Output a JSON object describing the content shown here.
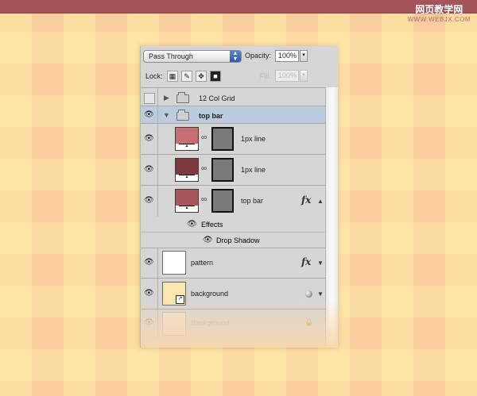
{
  "watermark": {
    "cn": "网页教学网",
    "url": "WWW.WEBJX.COM"
  },
  "panel": {
    "blend_mode": "Pass Through",
    "opacity_label": "Opacity:",
    "opacity_value": "100%",
    "lock_label": "Lock:",
    "fill_label": "Fill:",
    "fill_value": "100%"
  },
  "icons": {
    "eye": "👁",
    "triangle_right": "▶",
    "triangle_down": "▼",
    "chain": "🔗",
    "fx": "fx",
    "arrow_up": "▲",
    "arrow_down": "▼",
    "lock": "🔒",
    "style": "layer-style-icon"
  },
  "layers": {
    "group_12col": {
      "name": "12 Col Grid"
    },
    "group_topbar": {
      "name": "top bar"
    },
    "line1": {
      "name": "1px line",
      "color": "#c76e72"
    },
    "line2": {
      "name": "1px line",
      "color": "#7e3a3e"
    },
    "topbar_layer": {
      "name": "top bar",
      "color": "#a9565b"
    },
    "effects": {
      "label": "Effects"
    },
    "drop_shadow": {
      "label": "Drop Shadow"
    },
    "pattern": {
      "name": "pattern"
    },
    "background": {
      "name": "background",
      "color": "#fde6b0"
    },
    "background_ghost": {
      "name": "Background"
    }
  }
}
